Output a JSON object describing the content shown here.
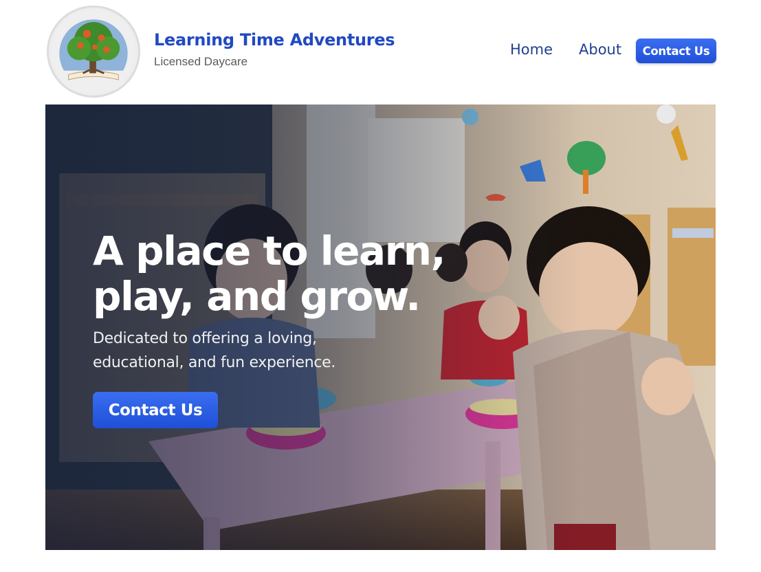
{
  "brand": {
    "title": "Learning Time Adventures",
    "subtitle": "Licensed Daycare",
    "logo_ring_text": "Learning Time Adventures",
    "logo_icon": "tree-on-book-logo"
  },
  "nav": {
    "home_label": "Home",
    "about_label": "About",
    "contact_label": "Contact Us"
  },
  "hero": {
    "title_line1": "A place to learn,",
    "title_line2": "play, and grow.",
    "subtitle_line1": "Dedicated to offering a loving,",
    "subtitle_line2": "educational, and fun experience.",
    "cta_label": "Contact Us",
    "image_alt": "children-eating-at-daycare-table-photo"
  },
  "colors": {
    "brand_blue": "#2149c2",
    "nav_text": "#1f3f8f",
    "button_blue": "#2a5ee6",
    "subtitle_gray": "#5a5a5a"
  }
}
